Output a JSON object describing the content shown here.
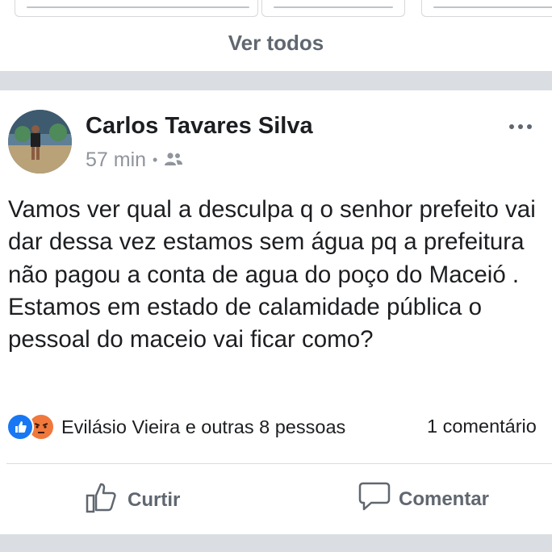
{
  "header": {
    "see_all_label": "Ver todos"
  },
  "post": {
    "author": "Carlos Tavares Silva",
    "time": "57 min",
    "separator": "•",
    "text": "Vamos ver qual a desculpa q o senhor prefeito vai dar dessa vez estamos sem água pq a prefeitura não pagou a conta de agua do poço do Maceió . Estamos em estado de calamidade pública o pessoal do maceio vai ficar como?",
    "reactions_text": "Evilásio Vieira e outras 8 pessoas",
    "comments_count": "1 comentário",
    "actions": {
      "like": "Curtir",
      "comment": "Comentar"
    }
  },
  "colors": {
    "facebook_blue": "#1877f2",
    "angry_orange": "#f0783c",
    "secondary_text": "#606770",
    "divider": "#dadde1"
  },
  "icons": {
    "privacy": "friends-icon",
    "like": "thumbs-up-icon",
    "comment": "speech-bubble-icon",
    "more": "ellipsis-icon"
  }
}
